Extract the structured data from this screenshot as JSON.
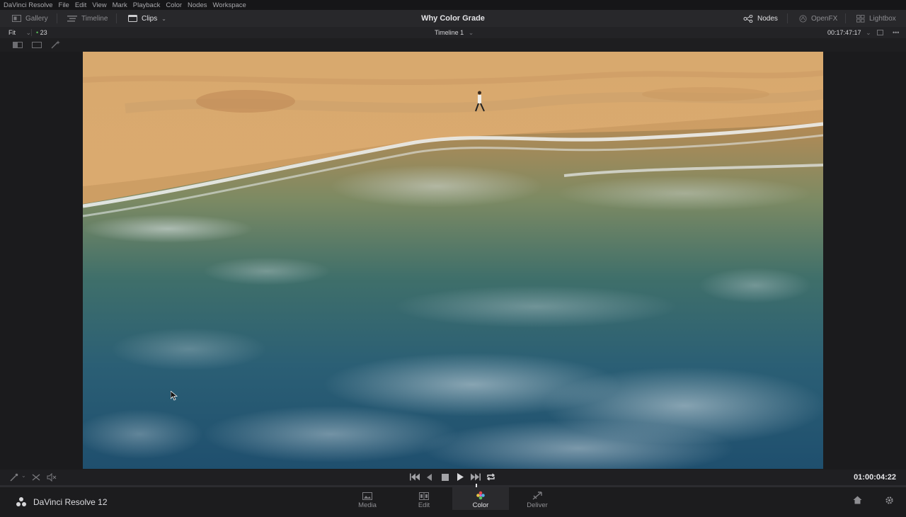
{
  "menu": {
    "items": [
      "DaVinci Resolve",
      "File",
      "Edit",
      "View",
      "Mark",
      "Playback",
      "Color",
      "Nodes",
      "Workspace"
    ]
  },
  "toolbar": {
    "gallery_label": "Gallery",
    "timeline_label": "Timeline",
    "clips_label": "Clips",
    "project_title": "Why Color Grade",
    "nodes_label": "Nodes",
    "openfx_label": "OpenFX",
    "lightbox_label": "Lightbox"
  },
  "viewer_bar": {
    "zoom": "Fit",
    "clip_number": "23",
    "timeline_name": "Timeline 1",
    "timecode": "00:17:47:17"
  },
  "transport": {
    "timecode": "01:00:04:22"
  },
  "pages": {
    "app_name": "DaVinci Resolve 12",
    "items": [
      {
        "label": "Media",
        "icon": "media-page-icon"
      },
      {
        "label": "Edit",
        "icon": "edit-page-icon"
      },
      {
        "label": "Color",
        "icon": "color-page-icon"
      },
      {
        "label": "Deliver",
        "icon": "deliver-page-icon"
      }
    ],
    "active": "Color"
  },
  "colors": {
    "accent": "#e64b4b",
    "panel": "#28282b",
    "background": "#1b1b1d"
  }
}
